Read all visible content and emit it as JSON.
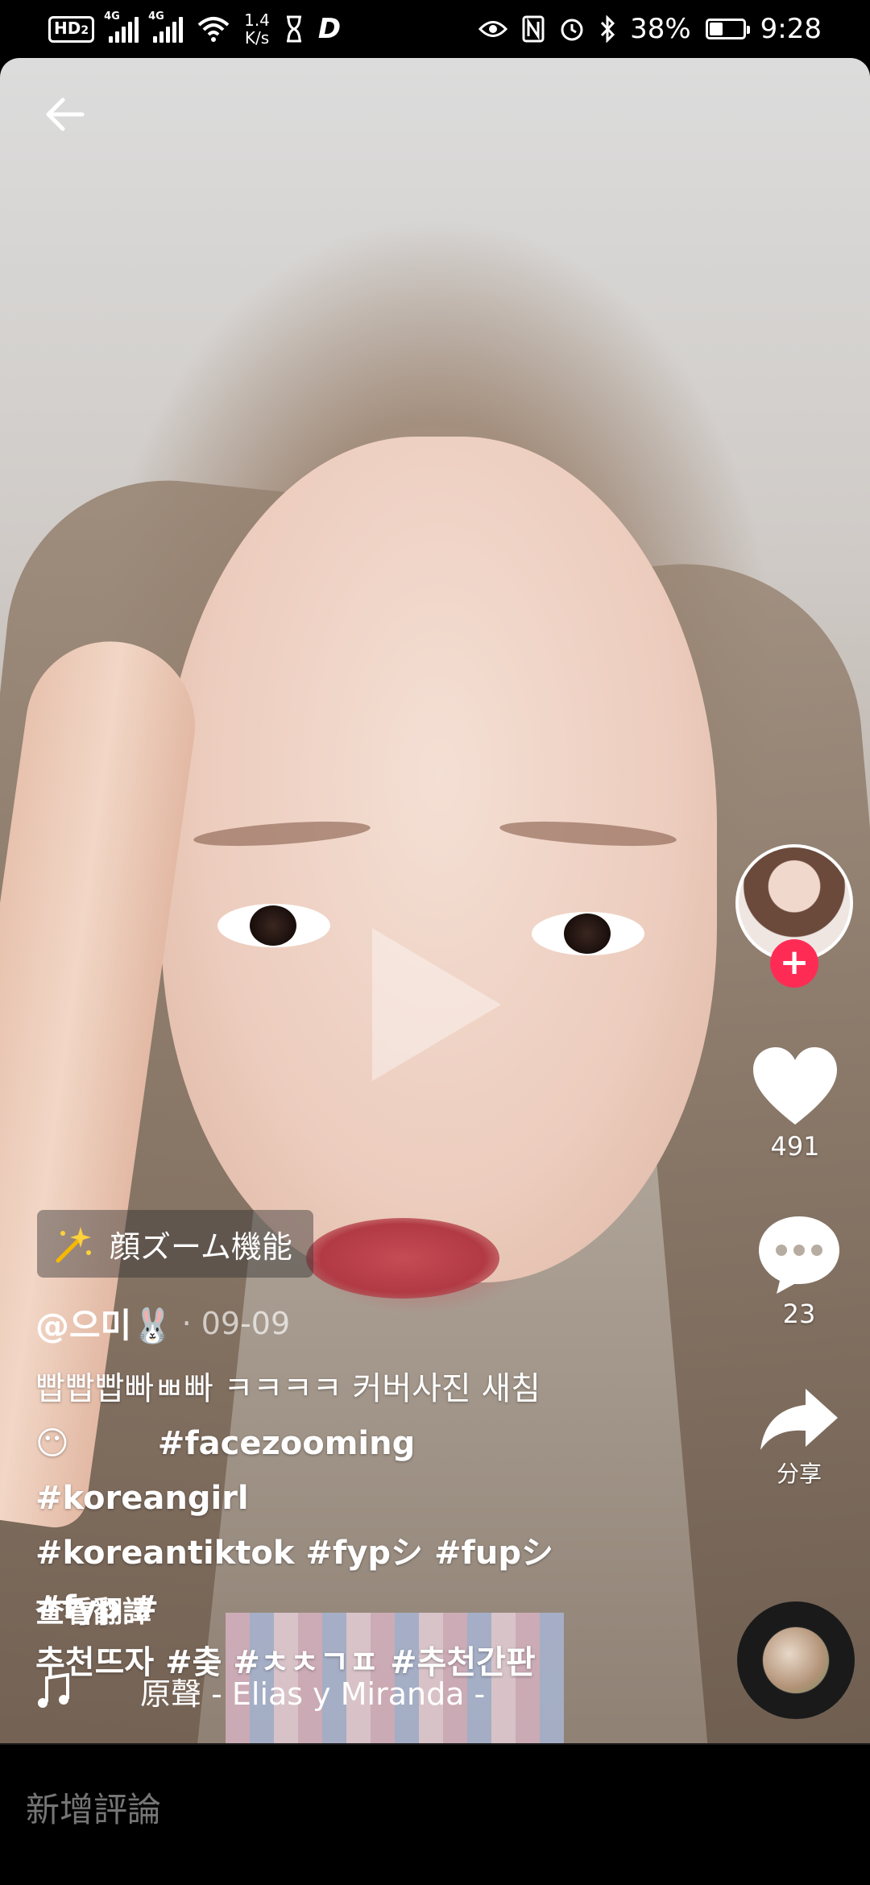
{
  "status_bar": {
    "hd": "HD",
    "hd_sub": "2",
    "net1": "4G",
    "net2": "4G",
    "speed_value": "1.4",
    "speed_unit": "K/s",
    "app_glyph": "D",
    "battery_percent": "38%",
    "time": "9:28"
  },
  "video": {
    "effect_label": "顔ズーム機能",
    "effect_icon": "sparkle-wand-icon"
  },
  "author": {
    "handle": "@으미🐰",
    "date": "· 09-09"
  },
  "caption": {
    "line1": "빱빱빱빠ㅃ빠 ㅋㅋㅋㅋ 커버사진 새침",
    "line2_emoji": "😶",
    "line2": "#facezooming #koreangirl",
    "line3": "#koreantiktok #fypシ #fupシ #fyp #",
    "line4": "추천뜨자 #춪 #ㅊㅊㄱㅍ #추천간판"
  },
  "translate_label": "查看翻譯",
  "sound": {
    "text": "原聲 - Elias y Miranda -",
    "icon": "music-note-icon"
  },
  "actions": {
    "follow_label": "+",
    "likes": "491",
    "comments": "23",
    "share_label": "分享"
  },
  "comment_bar": {
    "placeholder": "新增評論"
  },
  "colors": {
    "accent": "#fe2c55",
    "background": "#000000",
    "text": "#ffffff"
  }
}
